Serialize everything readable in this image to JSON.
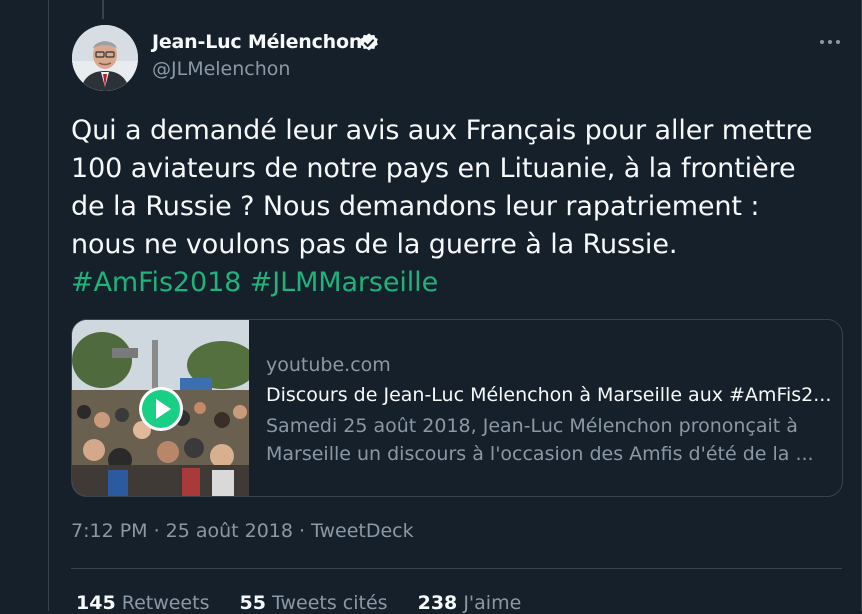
{
  "tweet": {
    "author": {
      "name": "Jean-Luc Mélenchon",
      "handle": "@JLMelenchon",
      "verified": true
    },
    "text_lines": [
      "Qui a demandé leur avis aux Français pour aller mettre",
      "100 aviateurs de notre pays en Lituanie, à la frontière",
      "de la Russie ? Nous demandons leur rapatriement :",
      "nous ne voulons pas de la guerre à la Russie."
    ],
    "hashtags": [
      "#AmFis2018",
      "#JLMMarseille"
    ],
    "card": {
      "domain": "youtube.com",
      "title": "Discours de Jean-Luc Mélenchon à Marseille aux #AmFis2...",
      "description_lines": [
        "Samedi 25 août 2018, Jean-Luc Mélenchon prononçait à",
        "Marseille un discours à l'occasion des Amfis d'été de la ..."
      ]
    },
    "meta": {
      "time": "7:12 PM",
      "date": "25 août 2018",
      "source": "TweetDeck",
      "separator": "·"
    },
    "stats": {
      "retweets": {
        "count": "145",
        "label": "Retweets"
      },
      "quotes": {
        "count": "55",
        "label": "Tweets cités"
      },
      "likes": {
        "count": "238",
        "label": "J'aime"
      }
    }
  },
  "colors": {
    "background": "#15202b",
    "border": "#38444d",
    "text_primary": "#f7f9f9",
    "text_secondary": "#8b98a5",
    "hashtag": "#1db37a",
    "verified_badge": "#f7f9f9",
    "play_button": "#19cf86"
  },
  "icons": {
    "verified": "verified-badge-icon",
    "more": "more-horizontal-icon",
    "play": "play-icon"
  }
}
